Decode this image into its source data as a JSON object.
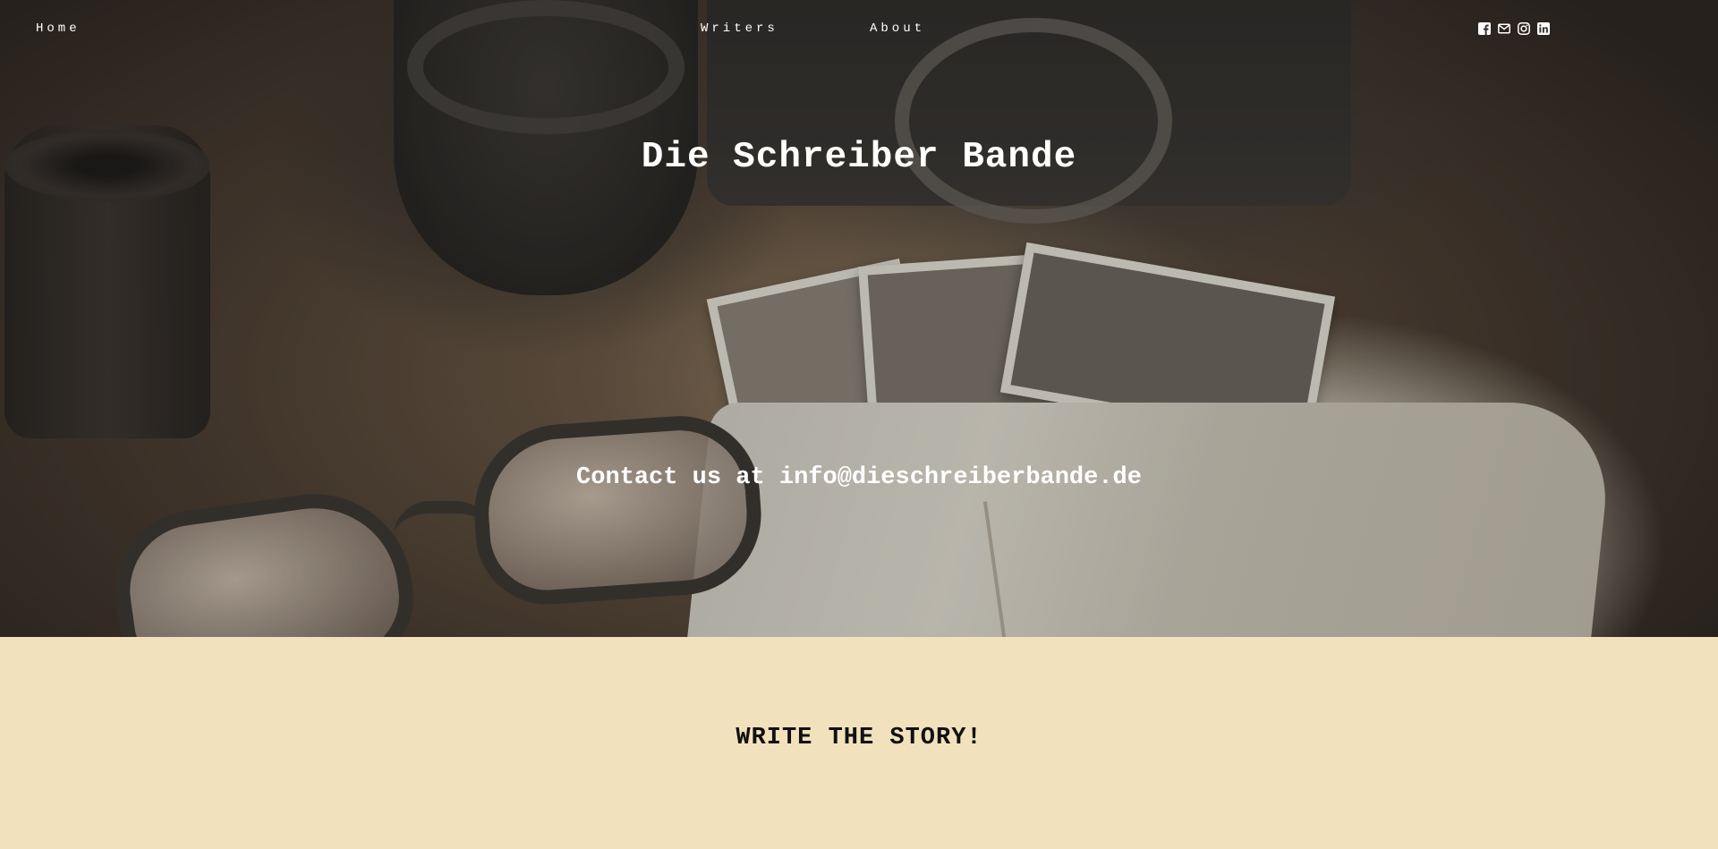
{
  "nav": {
    "home": "Home",
    "writers": "Writers",
    "about": "About"
  },
  "social": [
    {
      "icon": "facebook-icon"
    },
    {
      "icon": "email-icon"
    },
    {
      "icon": "instagram-icon"
    },
    {
      "icon": "linkedin-icon"
    }
  ],
  "hero": {
    "title": "Die Schreiber Bande",
    "contact": "Contact us at info@dieschreiberbande.de"
  },
  "story": {
    "title": "WRITE THE STORY!"
  },
  "colors": {
    "page_background": "#f2e1bd",
    "hero_text": "#ffffff",
    "story_text": "#111111"
  }
}
